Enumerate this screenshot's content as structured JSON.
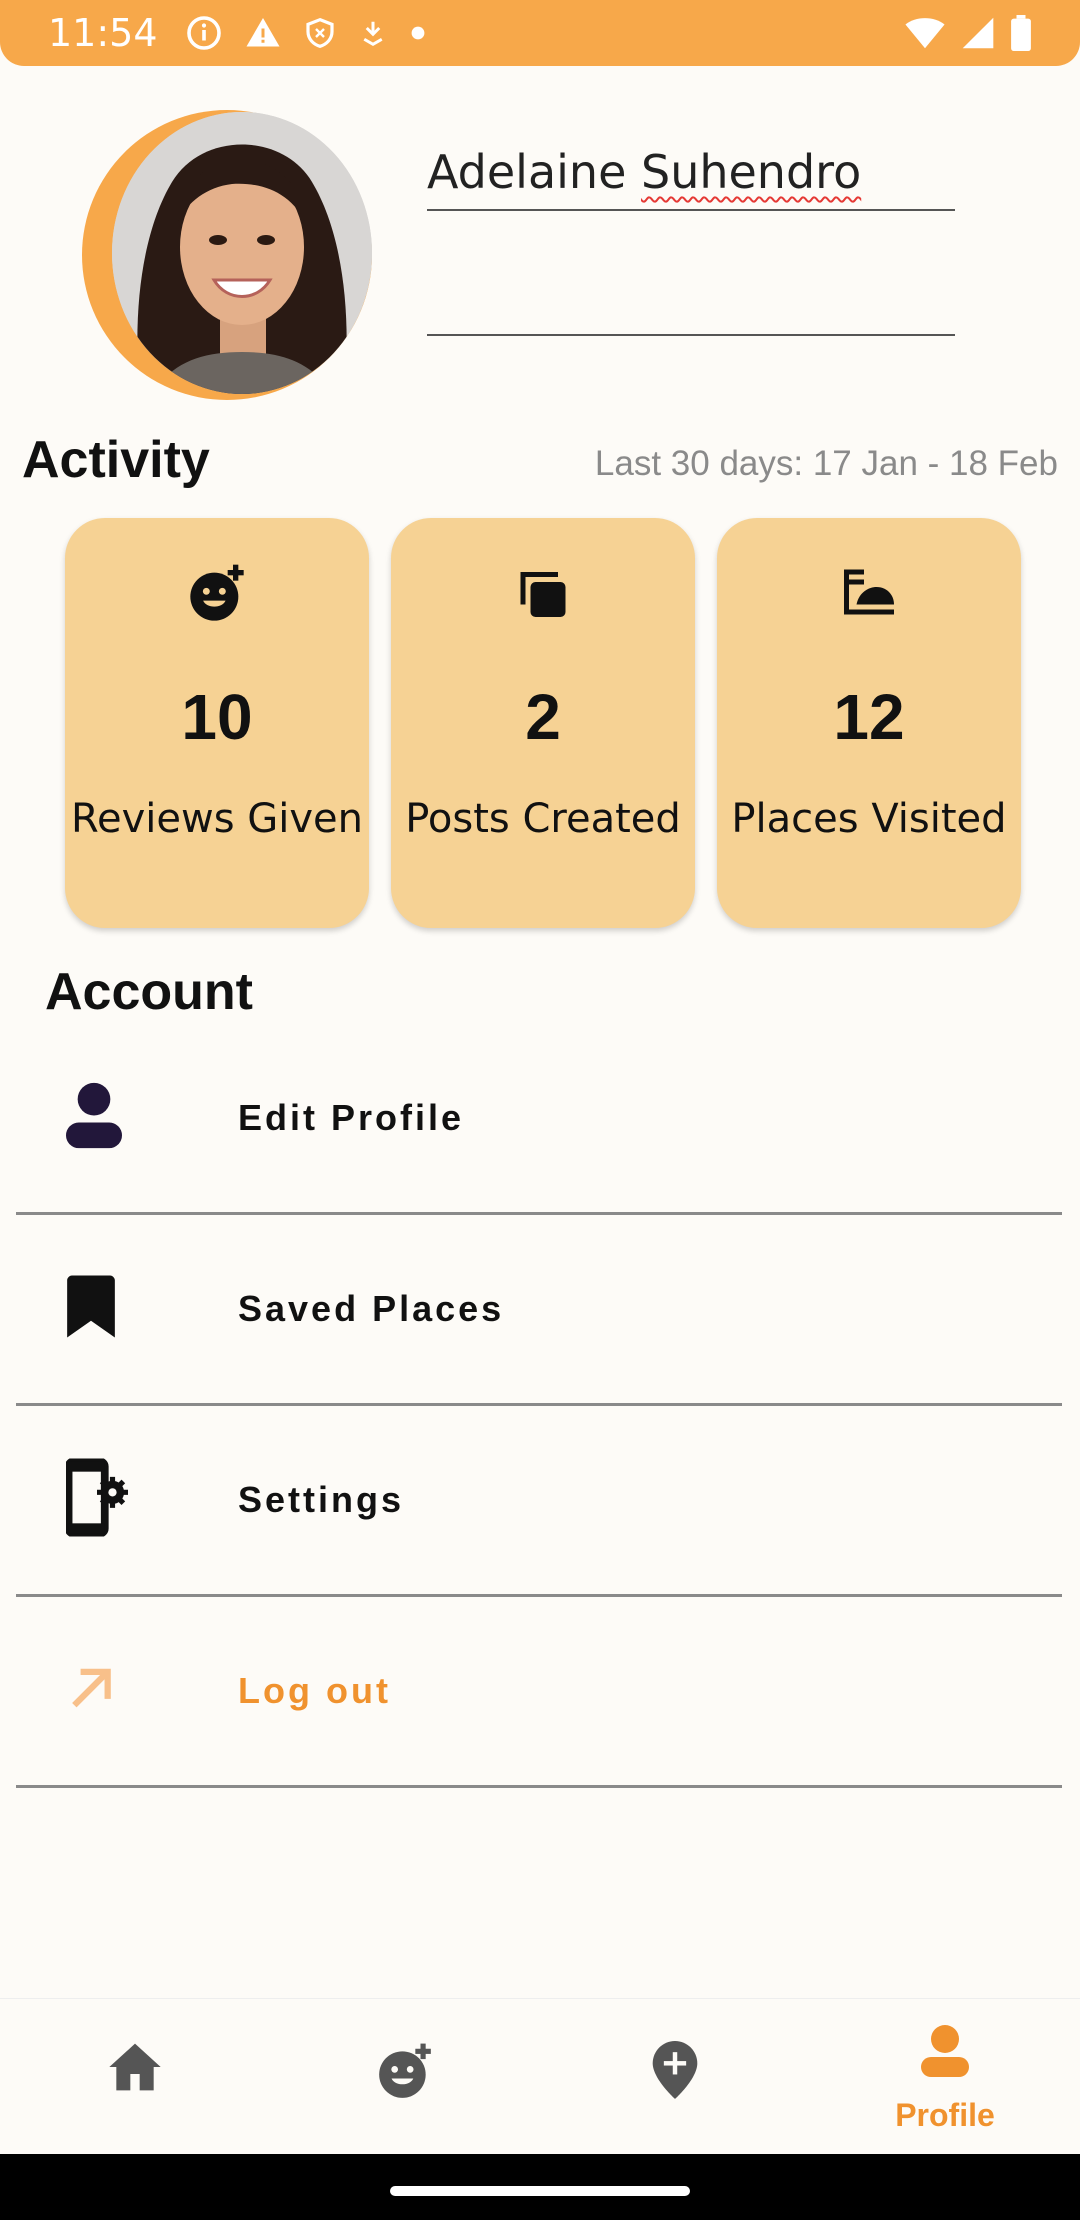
{
  "status_bar": {
    "time": "11:54",
    "color": "#F7A84A"
  },
  "profile": {
    "name_first": "Adelaine",
    "name_last": "Suhendro",
    "bio": ""
  },
  "activity": {
    "title": "Activity",
    "range": "Last 30 days: 17 Jan - 18 Feb",
    "cards": [
      {
        "icon": "add-reaction-icon",
        "value": "10",
        "label": "Reviews Given"
      },
      {
        "icon": "library-copies-icon",
        "value": "2",
        "label": "Posts Created"
      },
      {
        "icon": "bed-place-icon",
        "value": "12",
        "label": "Places Visited"
      }
    ],
    "card_color": "#F6D294"
  },
  "account": {
    "title": "Account",
    "items": [
      {
        "icon": "person-icon",
        "label": "Edit Profile"
      },
      {
        "icon": "bookmark-icon",
        "label": "Saved Places"
      },
      {
        "icon": "phone-settings-icon",
        "label": "Settings"
      },
      {
        "icon": "arrow-up-right-icon",
        "label": "Log out"
      }
    ]
  },
  "nav": {
    "items": [
      {
        "icon": "home-icon",
        "label": ""
      },
      {
        "icon": "add-reaction-icon",
        "label": ""
      },
      {
        "icon": "add-location-icon",
        "label": ""
      },
      {
        "icon": "person-icon",
        "label": "Profile"
      }
    ],
    "active_color": "#F0922E"
  }
}
